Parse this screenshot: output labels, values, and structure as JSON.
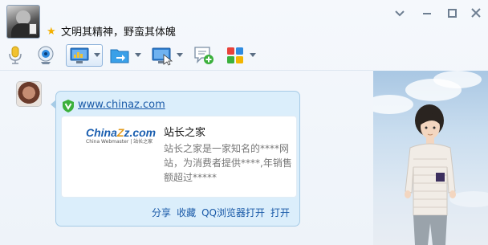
{
  "header": {
    "signature": "文明其精神，野蛮其体魄"
  },
  "toolbar": {
    "items": [
      "mic-icon",
      "camera-icon",
      "screen-share-icon",
      "file-transfer-icon",
      "remote-desktop-icon",
      "chat-add-icon",
      "apps-icon"
    ]
  },
  "message": {
    "link": "www.chinaz.com",
    "card_title": "站长之家",
    "card_desc": "站长之家是一家知名的****网站，为消费者提供****,年销售额超过*****",
    "logo_main": "China",
    "logo_main2": "z.com",
    "logo_sub": "China Webmaster | 站长之家",
    "actions": [
      "分享",
      "收藏",
      "QQ浏览器打开",
      "打开"
    ]
  },
  "colors": {
    "accent": "#1a5aa8",
    "card_bg": "#dbeefb",
    "shield": "#3bb03b"
  }
}
